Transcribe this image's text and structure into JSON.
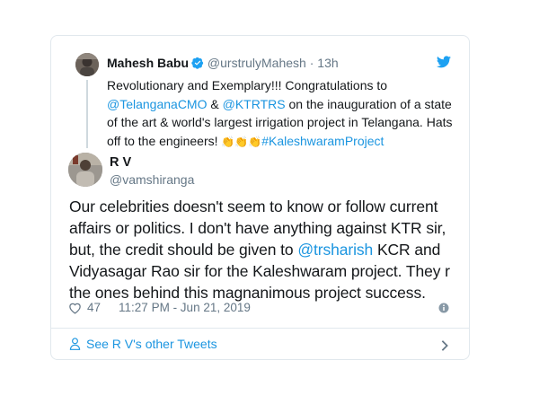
{
  "quoted": {
    "name": "Mahesh Babu",
    "handle": "@urstrulyMahesh",
    "dot": "·",
    "time": "13h",
    "text_1": "Revolutionary and Exemplary!!! Congratulations to ",
    "mention_1": "@TelanganaCMO",
    "text_2": " & ",
    "mention_2": "@KTRTRS",
    "text_3": " on the inauguration of a state of the art & world's largest irrigation project in Telangana. Hats off to the engineers! ",
    "claps": "👏👏👏",
    "hashtag": "#KaleshwaramProject"
  },
  "main": {
    "name": "R V",
    "handle": "@vamshiranga",
    "text_1": "Our celebrities doesn't seem to know or follow current affairs or politics. I don't have anything against KTR sir, but, the credit should be given to ",
    "mention": "@trsharish",
    "text_2": " KCR and Vidyasagar Rao sir for the Kaleshwaram project. They r the ones behind this magnanimous project success.",
    "likes": "47",
    "timestamp": "11:27 PM - Jun 21, 2019"
  },
  "footer": {
    "link": "See R V's other Tweets"
  },
  "icons": {
    "bird": "twitter-bird-icon",
    "verified": "verified-badge-icon",
    "heart": "heart-icon",
    "info": "info-icon",
    "person": "person-icon",
    "chevron": "chevron-right-icon"
  },
  "colors": {
    "accent": "#1b95e0",
    "muted": "#657786",
    "border": "#e1e8ed"
  }
}
